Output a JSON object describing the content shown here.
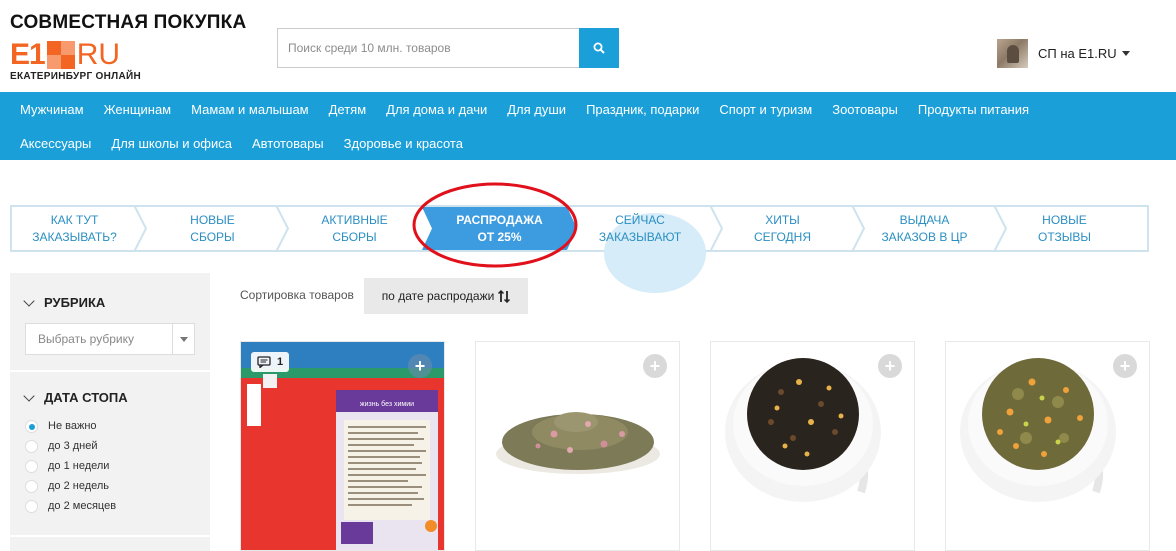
{
  "header": {
    "title": "СОВМЕСТНАЯ ПОКУПКА",
    "logo": {
      "e1": "E1",
      "ru": "RU",
      "subtitle": "ЕКАТЕРИНБУРГ ОНЛАЙН"
    },
    "search": {
      "placeholder": "Поиск среди 10 млн. товаров",
      "icon": "search-icon"
    },
    "user": {
      "label": "СП на E1.RU"
    }
  },
  "categories": {
    "row1": [
      "Мужчинам",
      "Женщинам",
      "Мамам и малышам",
      "Детям",
      "Для дома и дачи",
      "Для души",
      "Праздник, подарки",
      "Спорт и туризм",
      "Зоотовары",
      "Продукты питания"
    ],
    "row2": [
      "Аксессуары",
      "Для школы и офиса",
      "Автотовары",
      "Здоровье и красота"
    ]
  },
  "steps": [
    {
      "line1": "КАК ТУТ",
      "line2": "ЗАКАЗЫВАТЬ?"
    },
    {
      "line1": "НОВЫЕ",
      "line2": "СБОРЫ"
    },
    {
      "line1": "АКТИВНЫЕ",
      "line2": "СБОРЫ"
    },
    {
      "line1": "РАСПРОДАЖА",
      "line2": "ОТ 25%"
    },
    {
      "line1": "СЕЙЧАС",
      "line2": "ЗАКАЗЫВАЮТ"
    },
    {
      "line1": "ХИТЫ",
      "line2": "СЕГОДНЯ"
    },
    {
      "line1": "ВЫДАЧА",
      "line2": "ЗАКАЗОВ В ЦР"
    },
    {
      "line1": "НОВЫЕ",
      "line2": "ОТЗЫВЫ"
    }
  ],
  "sidebar": {
    "rubric": {
      "heading": "РУБРИКА",
      "select_placeholder": "Выбрать рубрику"
    },
    "stop_date": {
      "heading": "ДАТА СТОПА",
      "options": [
        "Не важно",
        "до 3 дней",
        "до 1 недели",
        "до 2 недель",
        "до 2 месяцев"
      ],
      "selected": "Не важно"
    }
  },
  "sort": {
    "label": "Сортировка товаров",
    "value": "по дате распродажи",
    "icon": "sort-arrows-icon"
  },
  "products": [
    {
      "comments": "1",
      "product_text": "жизнь без химии"
    },
    {
      "comments": ""
    },
    {
      "comments": ""
    },
    {
      "comments": ""
    }
  ],
  "colors": {
    "accent": "#1a9fd8",
    "brand": "#f26522",
    "active_step": "#3d9be0",
    "annotation": "#e0111b"
  }
}
